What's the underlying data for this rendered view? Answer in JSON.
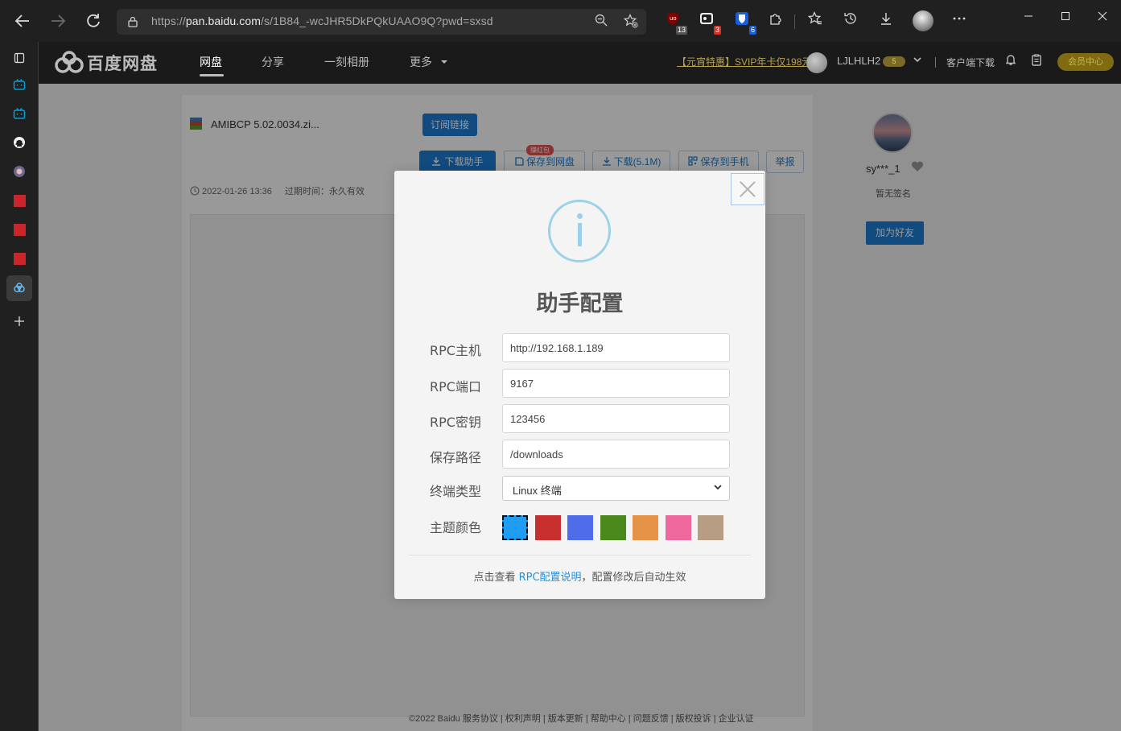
{
  "browser": {
    "url_prefix": "https://",
    "url_host": "pan.baidu.com",
    "url_path": "/s/1B84_-wcJHR5DkPQkUAAO9Q?pwd=sxsd",
    "extensions": [
      {
        "name": "ublock-icon",
        "badge": "13",
        "badge_color": "#555555"
      },
      {
        "name": "capture-icon",
        "badge": "3",
        "badge_color": "#d93025"
      },
      {
        "name": "bitwarden-icon",
        "badge": "6",
        "badge_color": "#175ddc"
      }
    ]
  },
  "site": {
    "logo_text": "百度网盘",
    "nav": [
      "网盘",
      "分享",
      "一刻相册",
      "更多"
    ],
    "promo": "【元宵特惠】SVIP年卡仅198元",
    "user_name": "LJLHLH2",
    "vip_level": "5",
    "client_download": "客户端下载",
    "vip_center": "会员中心"
  },
  "file": {
    "name": "AMIBCP 5.02.0034.zi...",
    "subscribe_label": "订阅链接",
    "actions": {
      "download_helper": "下载助手",
      "save_to_disk": "保存到网盘",
      "download": "下载(5.1M)",
      "save_to_phone": "保存到手机",
      "report": "举报"
    },
    "red_tag": "赚红包",
    "date": "2022-01-26 13:36",
    "expire_label": "过期时间：永久有效"
  },
  "sharer": {
    "name": "sy***_1",
    "signature": "暂无签名",
    "add_friend": "加为好友"
  },
  "footer": "©2022 Baidu  服务协议 | 权利声明 | 版本更新 | 帮助中心 | 问题反馈 | 版权投诉 | 企业认证",
  "modal": {
    "title": "助手配置",
    "fields": {
      "rpc_host_label": "RPC主机",
      "rpc_host_value": "http://192.168.1.189",
      "rpc_port_label": "RPC端口",
      "rpc_port_value": "9167",
      "rpc_secret_label": "RPC密钥",
      "rpc_secret_value": "123456",
      "save_path_label": "保存路径",
      "save_path_value": "/downloads",
      "terminal_label": "终端类型",
      "terminal_value": "Linux 终端",
      "theme_label": "主题颜色"
    },
    "theme_colors": [
      "#1f9df5",
      "#c7302f",
      "#4f6de8",
      "#4a8a1c",
      "#e59347",
      "#ee679d",
      "#b79e82"
    ],
    "selected_theme": 0,
    "footer_prefix": "点击查看 ",
    "footer_link": "RPC配置说明",
    "footer_suffix": "，配置修改后自动生效"
  }
}
